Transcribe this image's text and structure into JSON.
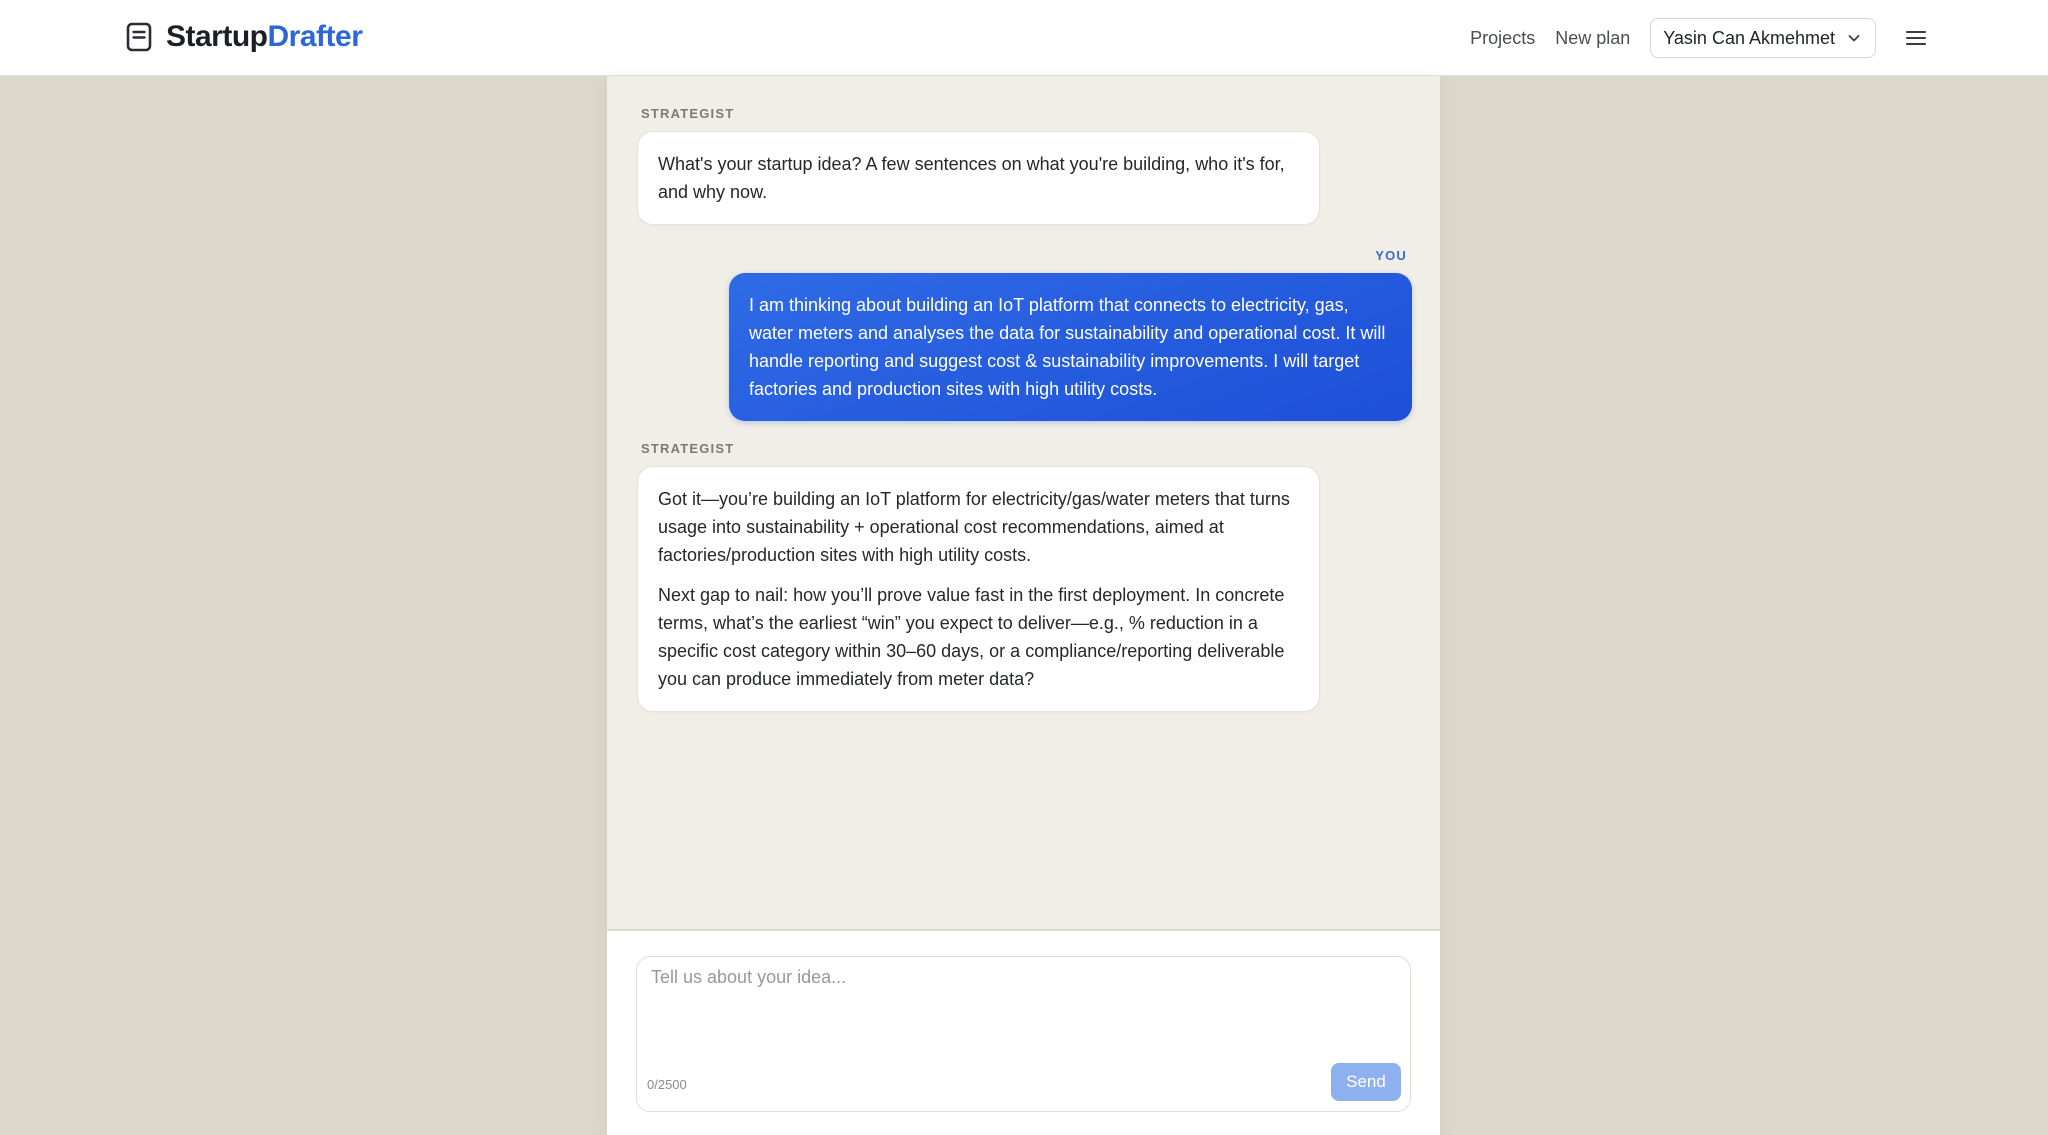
{
  "header": {
    "brand": {
      "name_part1": "Startup",
      "name_part2": "Drafter",
      "icon": "document-icon"
    },
    "nav": {
      "projects": "Projects",
      "new_plan": "New plan"
    },
    "user": {
      "name": "Yasin Can Akmehmet",
      "icon": "chevron-down-icon"
    },
    "menu_icon": "hamburger-menu-icon"
  },
  "chat": {
    "messages": [
      {
        "role_label": "STRATEGIST",
        "paragraphs": [
          "What's your startup idea? A few sentences on what you're building, who it's for, and why now."
        ]
      },
      {
        "role_label": "YOU",
        "paragraphs": [
          "I am thinking about building an IoT platform that connects to electricity, gas, water meters and analyses the data for sustainability and operational cost. It will handle reporting and suggest cost & sustainability improvements. I will target factories and production sites with high utility costs."
        ]
      },
      {
        "role_label": "STRATEGIST",
        "paragraphs": [
          "Got it—you’re building an IoT platform for electricity/gas/water meters that turns usage into sustainability + operational cost recommendations, aimed at factories/production sites with high utility costs.",
          "Next gap to nail: how you’ll prove value fast in the first deployment. In concrete terms, what’s the earliest “win” you expect to deliver—e.g., % reduction in a specific cost category within 30–60 days, or a compliance/reporting deliverable you can produce immediately from meter data?"
        ]
      }
    ]
  },
  "composer": {
    "placeholder": "Tell us about your idea...",
    "value": "",
    "counter": "0/2500",
    "send_label": "Send"
  },
  "colors": {
    "accent": "#2f66d6",
    "user_bubble": "#1d4fd8",
    "background": "#dbd8ca",
    "panel": "#f1eee7",
    "send_disabled": "#8fb0f0"
  }
}
